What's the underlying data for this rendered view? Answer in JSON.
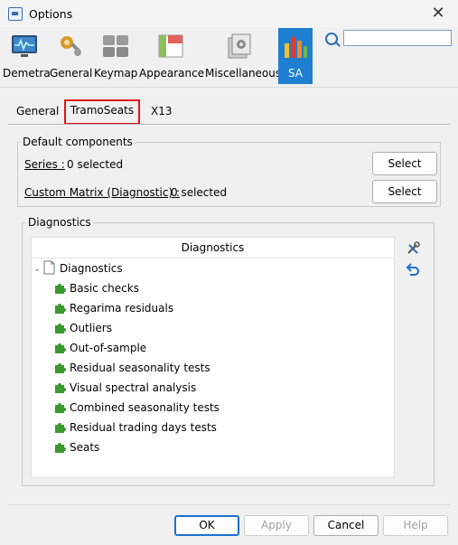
{
  "window": {
    "title": "Options"
  },
  "categories": [
    {
      "label": "Demetra",
      "icon": "demetra-icon",
      "selected": false
    },
    {
      "label": "General",
      "icon": "general-settings-icon",
      "selected": false
    },
    {
      "label": "Keymap",
      "icon": "keymap-icon",
      "selected": false
    },
    {
      "label": "Appearance",
      "icon": "appearance-icon",
      "selected": false
    },
    {
      "label": "Miscellaneous",
      "icon": "miscellaneous-icon",
      "selected": false
    },
    {
      "label": "SA",
      "icon": "sa-chart-icon",
      "selected": true
    }
  ],
  "search": {
    "value": "",
    "placeholder": ""
  },
  "tabs": [
    {
      "label": "General",
      "selected": false
    },
    {
      "label": "TramoSeats",
      "selected": true
    },
    {
      "label": "X13",
      "selected": false
    }
  ],
  "default_components": {
    "title": "Default components",
    "series_label": "Series :",
    "series_value": "0 selected",
    "matrix_label": "Custom Matrix (Diagnostic) :",
    "matrix_value": "0 selected",
    "select_label": "Select"
  },
  "diagnostics": {
    "title": "Diagnostics",
    "column_header": "Diagnostics",
    "root": "Diagnostics",
    "items": [
      "Basic checks",
      "Regarima residuals",
      "Outliers",
      "Out-of-sample",
      "Residual seasonality tests",
      "Visual spectral analysis",
      "Combined seasonality tests",
      "Residual trading days tests",
      "Seats"
    ]
  },
  "footer": {
    "ok": "OK",
    "apply": "Apply",
    "cancel": "Cancel",
    "help": "Help"
  },
  "colors": {
    "accent": "#1e7fd0",
    "highlight_border": "#e0161b",
    "puzzle_green": "#3a9a2e"
  }
}
